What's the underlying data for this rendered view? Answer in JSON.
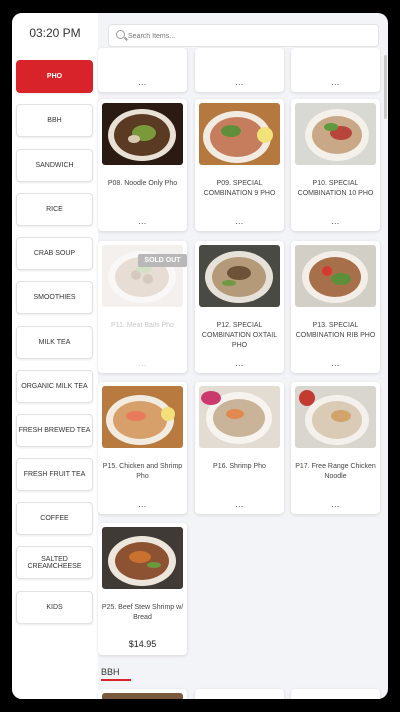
{
  "header": {
    "time": "03:20 PM"
  },
  "search": {
    "placeholder": "Search Items..."
  },
  "categories": [
    {
      "label": "PHO",
      "active": true
    },
    {
      "label": "BBH"
    },
    {
      "label": "SANDWICH"
    },
    {
      "label": "RICE"
    },
    {
      "label": "CRAB SOUP"
    },
    {
      "label": "SMOOTHIES"
    },
    {
      "label": "MILK TEA"
    },
    {
      "label": "ORGANIC MILK TEA"
    },
    {
      "label": "FRESH BREWED TEA"
    },
    {
      "label": "FRESH FRUIT TEA"
    },
    {
      "label": "COFFEE"
    },
    {
      "label": "SALTED CREAMCHEESE"
    },
    {
      "label": "KIDS"
    }
  ],
  "items": [
    {
      "name": "",
      "dots": "..."
    },
    {
      "name": "",
      "dots": "..."
    },
    {
      "name": "",
      "dots": "..."
    },
    {
      "name": "P08. Noodle Only Pho",
      "dots": "..."
    },
    {
      "name": "P09. SPECIAL COMBINATION 9 PHO",
      "dots": "..."
    },
    {
      "name": "P10. SPECIAL COMBINATION 10 PHO",
      "dots": "..."
    },
    {
      "name": "P11. Meat Balls Pho",
      "dots": "...",
      "sold_out": "SOLD OUT"
    },
    {
      "name": "P12. SPECIAL COMBINATION OXTAIL PHO",
      "dots": "..."
    },
    {
      "name": "P13. SPECIAL COMBINATION RIB PHO",
      "dots": "..."
    },
    {
      "name": "P15. Chicken and Shrimp Pho",
      "dots": "..."
    },
    {
      "name": "P16. Shrimp Pho",
      "dots": "..."
    },
    {
      "name": "P17. Free Range Chicken Noodle",
      "dots": "..."
    },
    {
      "name": "P25. Beef Stew Shrimp w/ Bread",
      "price": "$14.95"
    }
  ],
  "section_next": {
    "title": "BBH"
  },
  "colors": {
    "accent": "#d8232a"
  }
}
